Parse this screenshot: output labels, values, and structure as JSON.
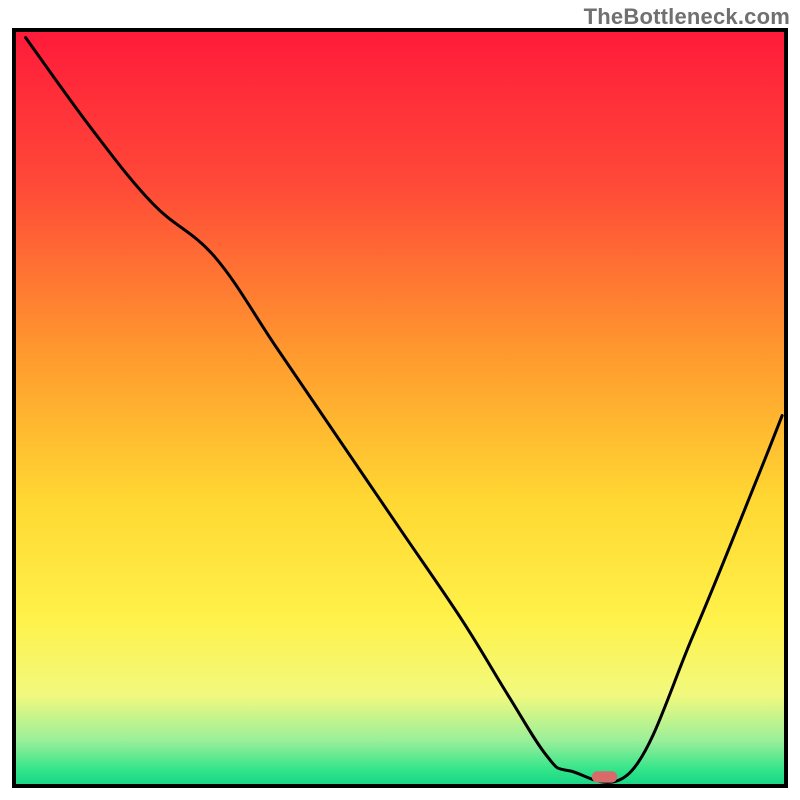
{
  "watermark": "TheBottleneck.com",
  "chart_data": {
    "type": "line",
    "title": "",
    "xlabel": "",
    "ylabel": "",
    "xlim": [
      0,
      100
    ],
    "ylim": [
      0,
      100
    ],
    "grid": false,
    "legend": false,
    "annotations": [],
    "background": {
      "type": "vertical-gradient",
      "stops": [
        {
          "pos": 0.0,
          "color": "#ff1a3a"
        },
        {
          "pos": 0.2,
          "color": "#ff4838"
        },
        {
          "pos": 0.43,
          "color": "#ff9a2e"
        },
        {
          "pos": 0.62,
          "color": "#ffd732"
        },
        {
          "pos": 0.78,
          "color": "#fff24a"
        },
        {
          "pos": 0.88,
          "color": "#f1f97e"
        },
        {
          "pos": 0.94,
          "color": "#9aef9a"
        },
        {
          "pos": 0.98,
          "color": "#2fe489"
        },
        {
          "pos": 1.0,
          "color": "#17d487"
        }
      ]
    },
    "series": [
      {
        "name": "bottleneck-curve",
        "color": "#000000",
        "x": [
          1.5,
          10,
          18,
          26,
          34,
          42,
          50,
          58,
          64,
          69,
          72,
          80,
          88,
          96,
          99.5
        ],
        "y": [
          99,
          87,
          77,
          70,
          58,
          46,
          34,
          22,
          12,
          4,
          2,
          2,
          20,
          40,
          49
        ]
      }
    ],
    "marker": {
      "name": "optimal-point",
      "shape": "rounded-rect",
      "color": "#d86a6a",
      "x": 76.5,
      "y": 1.2,
      "w": 3.3,
      "h": 1.5
    },
    "frame": {
      "color": "#000000",
      "width": 4
    }
  }
}
